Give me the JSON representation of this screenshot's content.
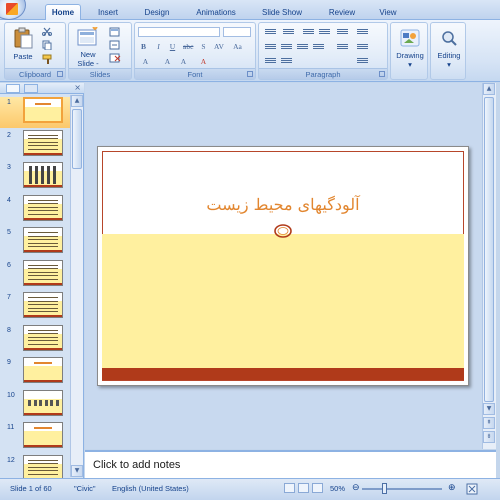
{
  "tabs": [
    "Home",
    "Insert",
    "Design",
    "Animations",
    "Slide Show",
    "Review",
    "View"
  ],
  "ribbon": {
    "clipboard": {
      "label": "Clipboard",
      "paste": "Paste"
    },
    "slides": {
      "label": "Slides",
      "new_slide_line1": "New",
      "new_slide_line2": "Slide -"
    },
    "font": {
      "label": "Font",
      "font_name": "",
      "font_size": ""
    },
    "paragraph": {
      "label": "Paragraph"
    },
    "drawing": {
      "label": "Drawing"
    },
    "editing": {
      "label": "Editing"
    }
  },
  "thumbnails": {
    "numbers": [
      "1",
      "2",
      "3",
      "4",
      "5",
      "6",
      "7",
      "8",
      "9",
      "10",
      "11",
      "12"
    ],
    "selected_index": 0
  },
  "slide": {
    "title": "آلودگیهای محیط زیست",
    "colors": {
      "title": "#e2862f",
      "band": "#fff09f",
      "bar": "#b03a1a"
    }
  },
  "notes": {
    "placeholder": "Click to add notes"
  },
  "status": {
    "slide_of": "Slide 1 of 60",
    "theme": "\"Civic\"",
    "language": "English (United States)",
    "zoom": "50%",
    "zoom_fraction": 0.5
  }
}
